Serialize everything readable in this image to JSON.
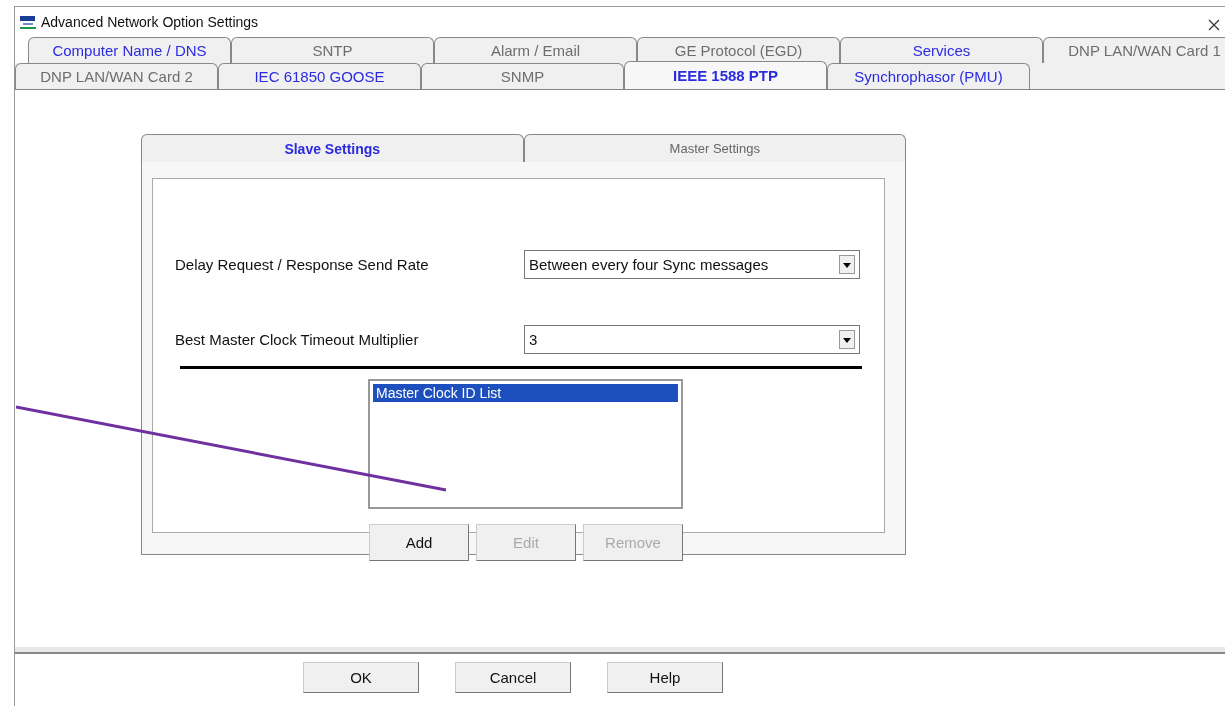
{
  "window": {
    "title": "Advanced Network Option Settings"
  },
  "tab_rows": [
    {
      "tabs": [
        {
          "label": "Computer Name / DNS",
          "selected": false,
          "color": "#2b2be0"
        },
        {
          "label": "SNTP",
          "selected": false,
          "color": "#6e6e6e"
        },
        {
          "label": "Alarm / Email",
          "selected": false,
          "color": "#6e6e6e"
        },
        {
          "label": "GE Protocol (EGD)",
          "selected": false,
          "color": "#6e6e6e"
        },
        {
          "label": "Services",
          "selected": false,
          "color": "#2b2be0"
        },
        {
          "label": "DNP LAN/WAN Card 1",
          "selected": false,
          "color": "#6e6e6e"
        }
      ]
    },
    {
      "tabs": [
        {
          "label": "DNP LAN/WAN Card 2",
          "selected": false,
          "color": "#6e6e6e"
        },
        {
          "label": "IEC 61850 GOOSE",
          "selected": false,
          "color": "#2b2be0"
        },
        {
          "label": "SNMP",
          "selected": false,
          "color": "#6e6e6e"
        },
        {
          "label": "IEEE 1588 PTP",
          "selected": true,
          "color": "#2b2be0"
        },
        {
          "label": "Synchrophasor (PMU)",
          "selected": false,
          "color": "#2b2be0"
        }
      ]
    }
  ],
  "inner_tabs": [
    {
      "label": "Slave Settings",
      "selected": true
    },
    {
      "label": "Master Settings",
      "selected": false
    }
  ],
  "fields": [
    {
      "label": "Delay Request / Response Send Rate",
      "value": "Between every four Sync messages"
    },
    {
      "label": "Best Master Clock Timeout Multiplier",
      "value": "3"
    }
  ],
  "list": {
    "items": [
      {
        "label": "Master Clock ID List",
        "selected": true
      }
    ]
  },
  "list_buttons": [
    {
      "label": "Add",
      "disabled": false
    },
    {
      "label": "Edit",
      "disabled": true
    },
    {
      "label": "Remove",
      "disabled": true
    }
  ],
  "buttons": [
    {
      "label": "OK"
    },
    {
      "label": "Cancel"
    },
    {
      "label": "Help"
    }
  ]
}
